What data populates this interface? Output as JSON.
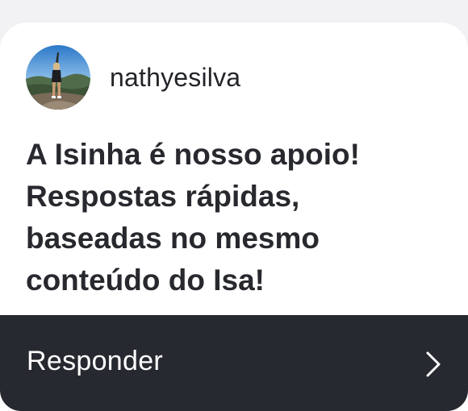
{
  "post": {
    "username": "nathyesilva",
    "message": "A Isinha é nosso apoio!\nRespostas rápidas,\nbaseadas no mesmo\nconteúdo do Isa!"
  },
  "reply": {
    "label": "Responder",
    "icon": "chevron-right-icon"
  },
  "colors": {
    "reply_bar_bg": "#262930",
    "text": "#27292e",
    "card_bg": "#ffffff"
  }
}
